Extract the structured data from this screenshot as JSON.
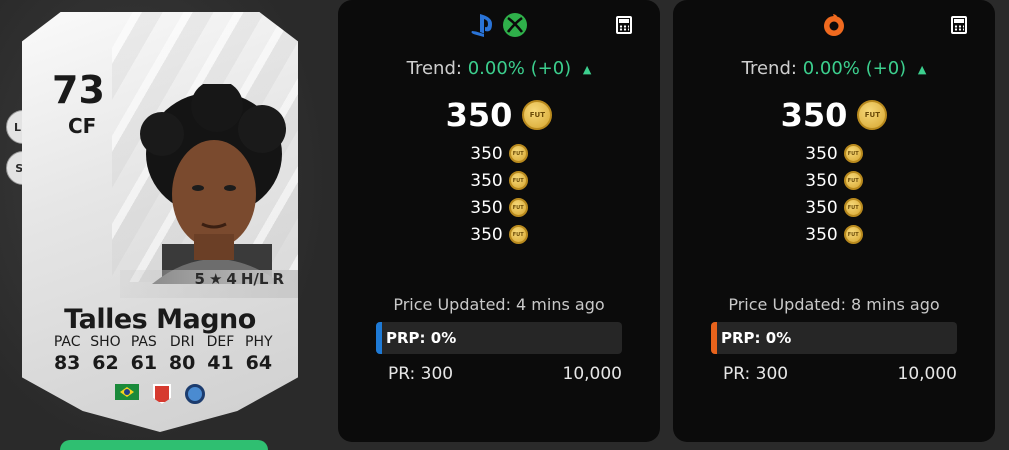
{
  "card": {
    "rating": "73",
    "position": "CF",
    "alt_positions": [
      "LM",
      "ST"
    ],
    "skills": "5",
    "weak_foot": "4",
    "work_rate": "H/L",
    "foot": "R",
    "name": "Talles Magno",
    "stats": [
      {
        "label": "PAC",
        "value": "83"
      },
      {
        "label": "SHO",
        "value": "62"
      },
      {
        "label": "PAS",
        "value": "61"
      },
      {
        "label": "DRI",
        "value": "80"
      },
      {
        "label": "DEF",
        "value": "41"
      },
      {
        "label": "PHY",
        "value": "64"
      }
    ]
  },
  "panels": [
    {
      "platform": "playstation-xbox",
      "accent": "#1e7ad6",
      "trend_label": "Trend:",
      "trend_value": "0.00% (+0)",
      "price": "350",
      "coin_text": "FUT",
      "recent_prices": [
        "350",
        "350",
        "350",
        "350"
      ],
      "updated": "Price Updated: 4 mins ago",
      "prp": "PRP: 0%",
      "pr_min": "PR: 300",
      "pr_max": "10,000"
    },
    {
      "platform": "pc-origin",
      "accent": "#e8631c",
      "trend_label": "Trend:",
      "trend_value": "0.00% (+0)",
      "price": "350",
      "coin_text": "FUT",
      "recent_prices": [
        "350",
        "350",
        "350",
        "350"
      ],
      "updated": "Price Updated: 8 mins ago",
      "prp": "PRP: 0%",
      "pr_min": "PR: 300",
      "pr_max": "10,000"
    }
  ],
  "colors": {
    "trend_green": "#3ccf8e",
    "coin_gold": "#d6a630",
    "panel_bg": "#0b0b0b"
  }
}
